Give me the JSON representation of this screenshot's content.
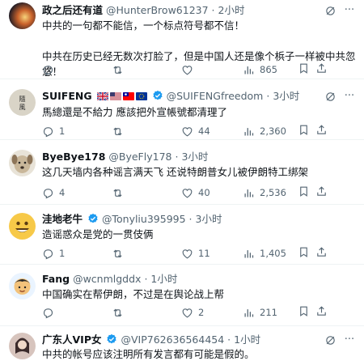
{
  "tweets": [
    {
      "name": "政之后还有道",
      "handle": "@HunterBrow61237",
      "dot": "·",
      "time": "2小时",
      "verified": false,
      "flags": [],
      "text": "中共的一句都不能信，一个标点符号都不信！\n\n中共在历史已经无数次打脸了，但是中国人还是像个梹子一样被中共忽悠！",
      "reply_count": "",
      "retweet_count": "",
      "like_count": "",
      "view_count": "865"
    },
    {
      "name": "SUIFENG",
      "handle": "@SUIFENGfreedom",
      "dot": "·",
      "time": "3小时",
      "verified": true,
      "flags": [
        "uk",
        "us",
        "tw",
        "eu"
      ],
      "text": "馬總還是不給力 應該把外宣帳號都清理了",
      "reply_count": "1",
      "retweet_count": "",
      "like_count": "44",
      "view_count": "2,360"
    },
    {
      "name": "ByeBye178",
      "handle": "@ByeFly178",
      "dot": "·",
      "time": "3小时",
      "verified": false,
      "flags": [],
      "text": "这几天墙内各种谣言满天飞 还说特朗普女儿被伊朗特工绑架",
      "reply_count": "4",
      "retweet_count": "",
      "like_count": "40",
      "view_count": "2,536"
    },
    {
      "name": "洼地老牛",
      "handle": "@Tonyliu395995",
      "dot": "·",
      "time": "3小时",
      "verified": true,
      "flags": [],
      "text": "造谣惑众是党的一贯伎俩",
      "reply_count": "1",
      "retweet_count": "",
      "like_count": "11",
      "view_count": "1,405"
    },
    {
      "name": "Fang",
      "handle": "@wcnmlgddx",
      "dot": "·",
      "time": "1小时",
      "verified": false,
      "flags": [],
      "text": "中国确实在帮伊朗，不过是在舆论战上帮",
      "reply_count": "",
      "retweet_count": "",
      "like_count": "2",
      "view_count": "211"
    },
    {
      "name": "广东人VIP女",
      "handle": "@VIP762636564454",
      "dot": "·",
      "time": "1小时",
      "verified": true,
      "flags": [],
      "text": "中共的帐号应该注明所有发言都有可能是假的。",
      "reply_count": "",
      "retweet_count": "",
      "like_count": "",
      "view_count": ""
    }
  ],
  "icons": {
    "reply": "reply-icon",
    "retweet": "retweet-icon",
    "like": "heart-icon",
    "views": "views-icon",
    "bookmark": "bookmark-icon",
    "share": "share-icon",
    "grok": "grok-icon",
    "more": "more-icon",
    "verified": "verified-badge-icon"
  },
  "colors": {
    "text_primary": "#0f1419",
    "text_secondary": "#536471",
    "verified_blue": "#1d9bf0",
    "divider": "#eff3f4"
  }
}
